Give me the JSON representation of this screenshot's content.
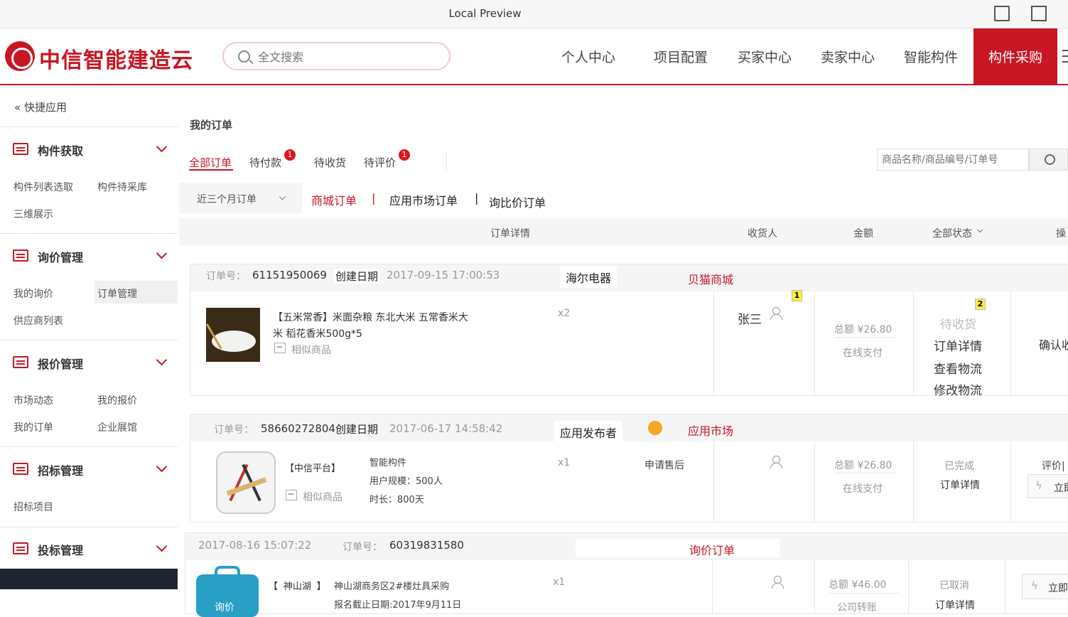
{
  "window": {
    "title": "Local Preview"
  },
  "header": {
    "logo_text": "中信智能建造云",
    "search_placeholder": "全文搜索",
    "nav": [
      "个人中心",
      "项目配置",
      "买家中心",
      "卖家中心",
      "智能构件"
    ],
    "nav_active": "构件采购"
  },
  "sidebar": {
    "quick": "« 快捷应用",
    "sections": [
      {
        "title": "构件获取",
        "links": [
          "构件列表选取",
          "构件待采库",
          "三维展示"
        ]
      },
      {
        "title": "询价管理",
        "links": [
          "我的询价",
          "订单管理",
          "供应商列表"
        ]
      },
      {
        "title": "报价管理",
        "links": [
          "市场动态",
          "我的报价",
          "我的订单",
          "企业展馆"
        ]
      },
      {
        "title": "招标管理",
        "links": [
          "招标项目"
        ]
      },
      {
        "title": "投标管理",
        "links": []
      }
    ]
  },
  "main": {
    "page_title": "我的订单",
    "tabs": [
      {
        "label": "全部订单",
        "badge": ""
      },
      {
        "label": "待付款",
        "badge": "1"
      },
      {
        "label": "待收货",
        "badge": ""
      },
      {
        "label": "待评价",
        "badge": "1"
      }
    ],
    "order_search_placeholder": "商品名称/商品编号/订单号",
    "filter_period": "近三个月订单",
    "filter_types": [
      "商城订单",
      "|",
      "应用市场订单",
      "|",
      "询比价订单"
    ],
    "columns": [
      "订单详情",
      "收货人",
      "金额",
      "全部状态",
      "操"
    ],
    "orders": [
      {
        "order_no_label": "订单号：",
        "order_no": "61151950069",
        "date_label": "创建日期",
        "date": "2017-09-15 17:00:53",
        "shop": "海尔电器",
        "source": "贝猫商城",
        "product_line1": "【五米常香】米面杂粮 东北大米 五常香米大",
        "product_line2": "米 稻花香米500g*5",
        "similar": "相似商品",
        "qty": "x2",
        "receiver": "张三",
        "marker1": "1",
        "marker2": "2",
        "amount": "总额 ¥26.80",
        "pay_method": "在线支付",
        "status": "待收货",
        "actions": [
          "订单详情",
          "查看物流",
          "修改物流"
        ],
        "op": "确认收"
      },
      {
        "order_no_label": "订单号：",
        "order_no": "58660272804",
        "date_label": "创建日期",
        "date": "2017-06-17 14:58:42",
        "shop": "应用发布者",
        "source": "应用市场",
        "product_platform": "【中信平台】",
        "product_name": "智能构件",
        "product_scale": "用户规模：500人",
        "product_duration": "时长：800天",
        "similar": "相似商品",
        "qty": "x1",
        "after_sale": "申请售后",
        "amount": "总额 ¥26.80",
        "pay_method": "在线支付",
        "status": "已完成",
        "actions": [
          "订单详情"
        ],
        "op_top": "评价|",
        "op_btn": "立即"
      },
      {
        "date": "2017-08-16 15:07:22",
        "order_no_label": "订单号：",
        "order_no": "60319831580",
        "source": "询价订单",
        "product_tag": "【 神山湖 】",
        "product_line1": "神山湖商务区2#楼灶具采购",
        "product_line2": "报名截止日期:2017年9月11日",
        "icon_text": "询价",
        "qty": "x1",
        "amount": "总额 ¥46.00",
        "pay_method": "公司转账",
        "status": "已取消",
        "actions": [
          "订单详情"
        ],
        "op_btn": "立即"
      }
    ]
  }
}
